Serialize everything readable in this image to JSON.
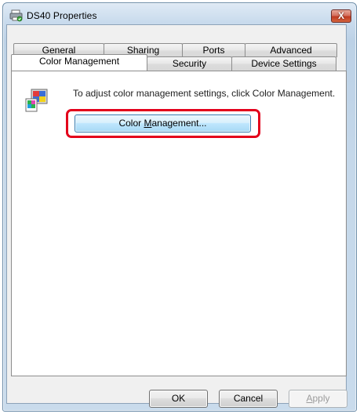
{
  "window": {
    "title": "DS40 Properties",
    "close_label": "X"
  },
  "tabs": {
    "row_back": [
      "General",
      "Sharing",
      "Ports",
      "Advanced"
    ],
    "row_front": [
      "Color Management",
      "Security",
      "Device Settings"
    ],
    "active": "Color Management"
  },
  "panel": {
    "instruction": "To adjust color management settings, click Color Management.",
    "button_pre": "Color ",
    "button_mnemonic": "M",
    "button_post": "anagement..."
  },
  "footer": {
    "ok_label": "OK",
    "cancel_label": "Cancel",
    "apply_mnemonic": "A",
    "apply_rest": "pply"
  },
  "colors": {
    "highlight": "#e3001b",
    "title_bar": "#c9dbed",
    "close_button": "#c03b22"
  },
  "icons": {
    "title": "printer-icon",
    "panel": "color-management-icon"
  }
}
